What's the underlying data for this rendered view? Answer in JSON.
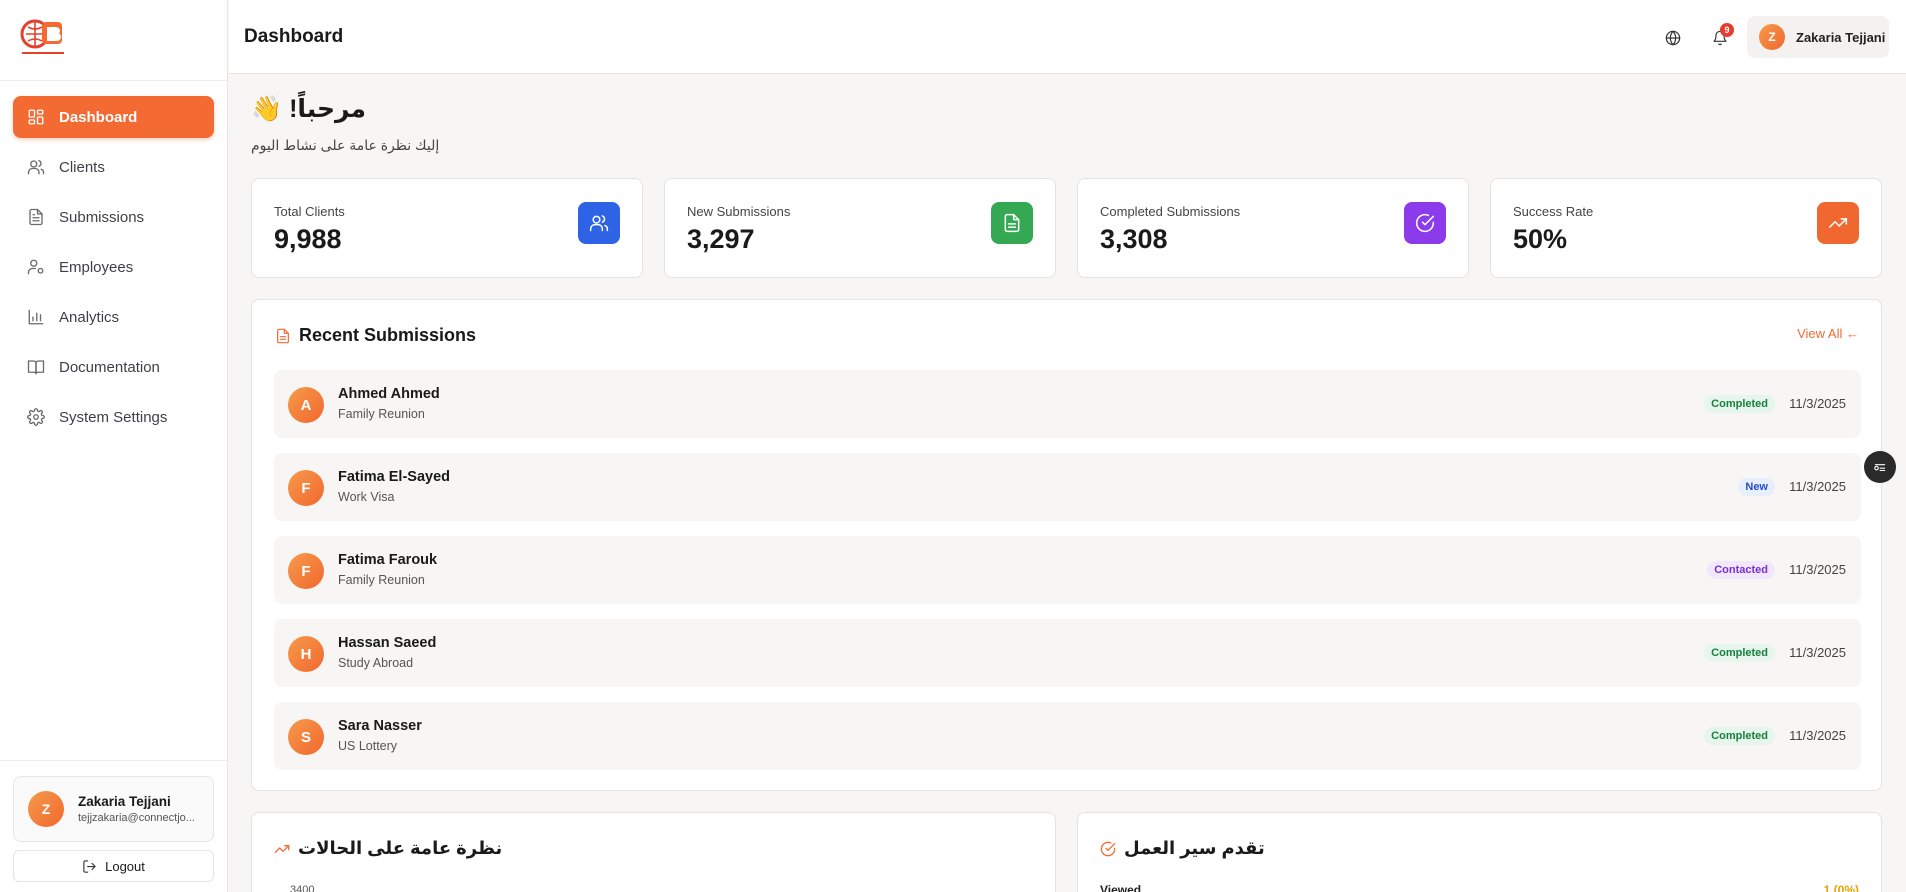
{
  "sidebar": {
    "logo_alt": "CONNECT THE WORLD",
    "items": [
      {
        "label": "Dashboard",
        "icon": "dashboard-icon",
        "active": true
      },
      {
        "label": "Clients",
        "icon": "users-icon"
      },
      {
        "label": "Submissions",
        "icon": "file-icon"
      },
      {
        "label": "Employees",
        "icon": "employee-icon"
      },
      {
        "label": "Analytics",
        "icon": "bar-chart-icon"
      },
      {
        "label": "Documentation",
        "icon": "book-icon"
      },
      {
        "label": "System Settings",
        "icon": "gear-icon"
      }
    ],
    "user": {
      "initial": "Z",
      "name": "Zakaria Tejjani",
      "email": "tejjzakaria@connectjo..."
    },
    "logout_label": "Logout"
  },
  "header": {
    "title": "Dashboard",
    "notification_count": "9",
    "user": {
      "initial": "Z",
      "name": "Zakaria Tejjani"
    }
  },
  "welcome": {
    "title": "مرحباً! 👋",
    "subtitle": "إليك نظرة عامة على نشاط اليوم"
  },
  "stats": [
    {
      "label": "Total Clients",
      "value": "9,988",
      "icon": "users-icon",
      "color": "#2e63e6"
    },
    {
      "label": "New Submissions",
      "value": "3,297",
      "icon": "file-icon",
      "color": "#34a853"
    },
    {
      "label": "Completed Submissions",
      "value": "3,308",
      "icon": "check-circle-icon",
      "color": "#8b3bea"
    },
    {
      "label": "Success Rate",
      "value": "50%",
      "icon": "trending-up-icon",
      "color": "#f0682f"
    }
  ],
  "recent": {
    "title": "Recent Submissions",
    "view_all": "View All ←",
    "rows": [
      {
        "initial": "A",
        "name": "Ahmed Ahmed",
        "type": "Family Reunion",
        "status": "Completed",
        "date": "11/3/2025"
      },
      {
        "initial": "F",
        "name": "Fatima El-Sayed",
        "type": "Work Visa",
        "status": "New",
        "date": "11/3/2025"
      },
      {
        "initial": "F",
        "name": "Fatima Farouk",
        "type": "Family Reunion",
        "status": "Contacted",
        "date": "11/3/2025"
      },
      {
        "initial": "H",
        "name": "Hassan Saeed",
        "type": "Study Abroad",
        "status": "Completed",
        "date": "11/3/2025"
      },
      {
        "initial": "S",
        "name": "Sara Nasser",
        "type": "US Lottery",
        "status": "Completed",
        "date": "11/3/2025"
      }
    ]
  },
  "status_colors": {
    "Completed": {
      "bg": "#e6f6ec",
      "fg": "#17803d"
    },
    "New": {
      "bg": "#e7eefc",
      "fg": "#2450c9"
    },
    "Contacted": {
      "bg": "#f2e8fc",
      "fg": "#7b2fd0"
    }
  },
  "bottom_panels": {
    "cases_title": "نظرة عامة على الحالات",
    "cases_axis_tick": "3400",
    "workflow_title": "تقدم سير العمل",
    "workflow_first_label": "Viewed",
    "workflow_first_value": "1 (0%)"
  },
  "colors": {
    "accent": "#f36a32"
  }
}
